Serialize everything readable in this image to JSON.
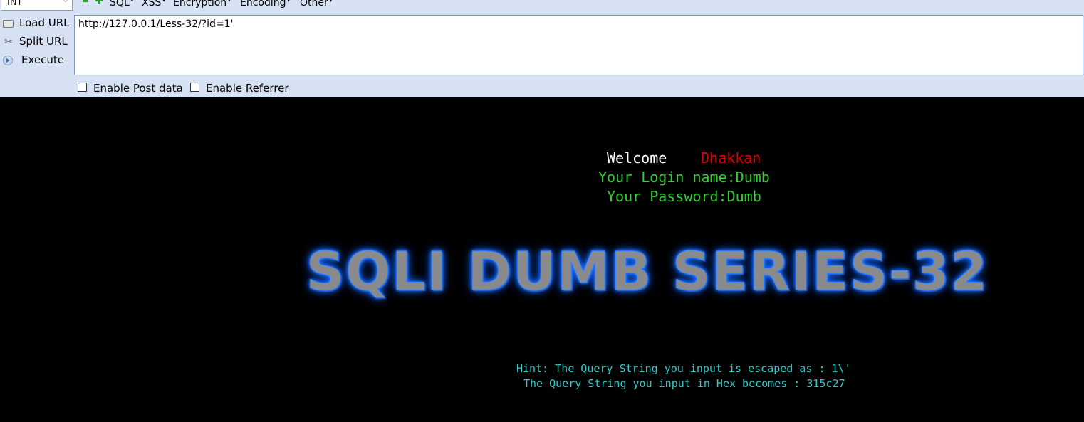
{
  "toolbar": {
    "select_value": "INT",
    "menu": {
      "sql": "SQL",
      "xss": "XSS",
      "encryption": "Encryption",
      "encoding": "Encoding",
      "other": "Other"
    },
    "load_url": "Load URL",
    "split_url": "Split URL",
    "execute": "Execute",
    "url_value": "http://127.0.0.1/Less-32/?id=1'",
    "enable_post_data": "Enable Post data",
    "enable_referrer": "Enable Referrer"
  },
  "page": {
    "welcome": "Welcome",
    "user": "Dhakkan",
    "login_name": "Your Login name:Dumb",
    "password": "Your Password:Dumb",
    "banner": "SQLI DUMB SERIES-32",
    "hint1": "Hint: The Query String you input is escaped as : 1\\'",
    "hint2": "The Query String you input in Hex becomes : 315c27"
  },
  "colors": {
    "toolbar_bg": "#d6e2f3",
    "page_bg": "#000000",
    "welcome": "#ffffff",
    "user": "#e00000",
    "login_text": "#33cc33",
    "hint_text": "#33c9c9",
    "banner_glow": "#1e73ff"
  }
}
